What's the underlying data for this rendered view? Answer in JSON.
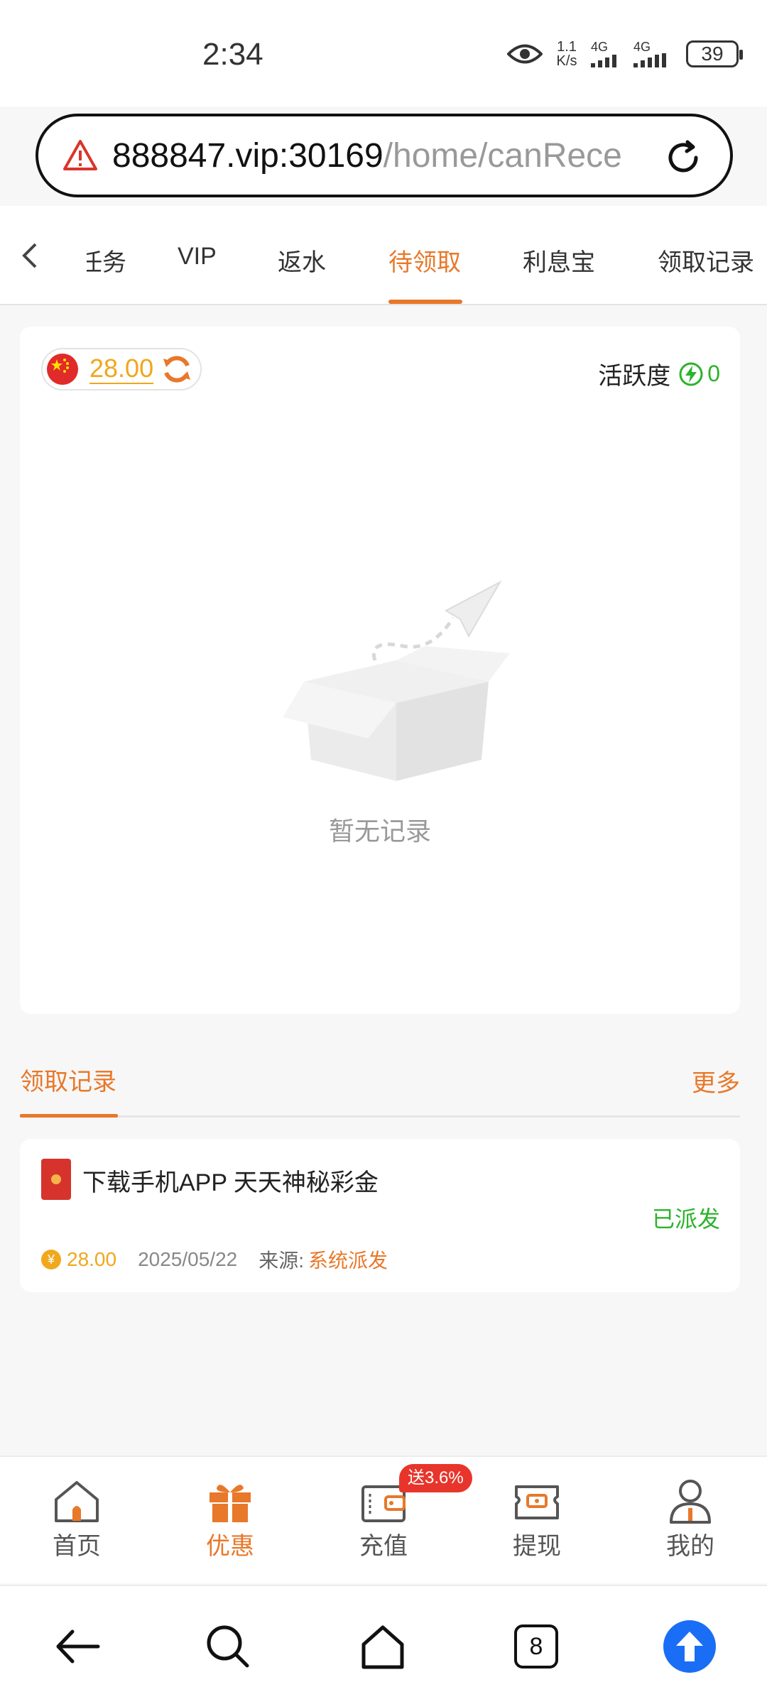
{
  "status_bar": {
    "time": "2:34",
    "net_speed_top": "1.1",
    "net_speed_bottom": "K/s",
    "sim1": "4G",
    "sim2": "4G",
    "battery": "39"
  },
  "browser": {
    "url_host": "888847.vip:30169",
    "url_path": "/home/canRecei"
  },
  "tabs": {
    "items": [
      "任务",
      "VIP",
      "返水",
      "待领取",
      "利息宝",
      "领取记录"
    ],
    "active": "待领取"
  },
  "card": {
    "balance": "28.00",
    "activity_label": "活跃度",
    "activity_value": "0",
    "empty_text": "暂无记录"
  },
  "records_section": {
    "title": "领取记录",
    "more": "更多"
  },
  "record": {
    "title": "下载手机APP 天天神秘彩金",
    "status": "已派发",
    "currency_symbol": "¥",
    "amount": "28.00",
    "date": "2025/05/22",
    "source_label": "来源:",
    "source_value": "系统派发"
  },
  "bottom_nav": {
    "items": [
      "首页",
      "优惠",
      "充值",
      "提现",
      "我的"
    ],
    "active": "优惠",
    "promo_badge": "送3.6%"
  },
  "system_nav": {
    "tab_count": "8"
  },
  "colors": {
    "accent": "#e8782a",
    "success": "#2bb32b",
    "gold": "#f0a71c",
    "badge": "#e8352b",
    "blue": "#1a6ef5"
  }
}
